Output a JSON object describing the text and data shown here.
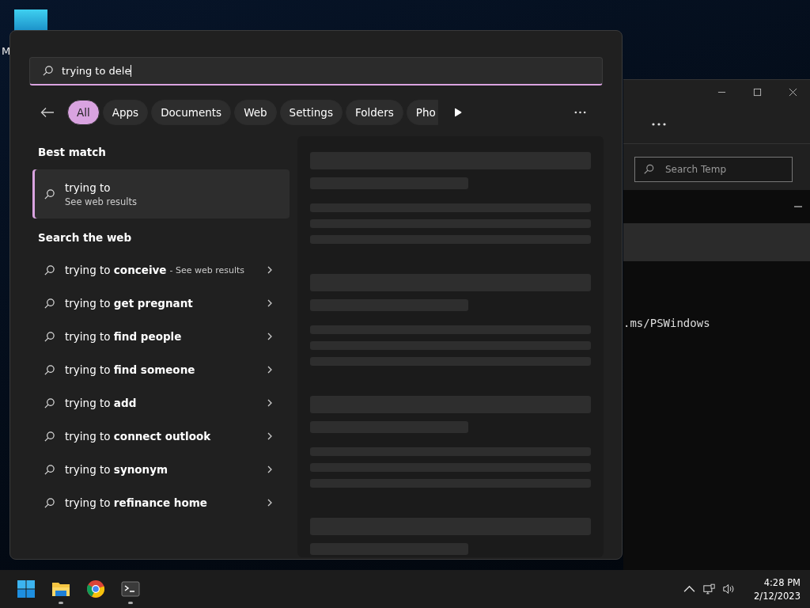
{
  "desktop": {
    "icon_label": "M"
  },
  "explorer_window": {
    "search_placeholder": "Search Temp"
  },
  "terminal_window": {
    "line": ".ms/PSWindows"
  },
  "search": {
    "query": "trying to dele",
    "filters": [
      {
        "label": "All",
        "selected": true
      },
      {
        "label": "Apps",
        "selected": false
      },
      {
        "label": "Documents",
        "selected": false
      },
      {
        "label": "Web",
        "selected": false
      },
      {
        "label": "Settings",
        "selected": false
      },
      {
        "label": "Folders",
        "selected": false
      },
      {
        "label": "Pho",
        "selected": false
      }
    ],
    "best_match": {
      "heading": "Best match",
      "title": "trying to",
      "subtitle": "See web results",
      "selected": true
    },
    "web": {
      "heading": "Search the web",
      "suggestions": [
        {
          "text": "trying to **conceive**",
          "note": "- See web results"
        },
        {
          "text": "trying to **get pregnant**"
        },
        {
          "text": "trying to **find people**"
        },
        {
          "text": "trying to **find someone**"
        },
        {
          "text": "trying to **add**"
        },
        {
          "text": "trying to **connect outlook**"
        },
        {
          "text": "trying to **synonym**"
        },
        {
          "text": "trying to **refinance home**"
        }
      ]
    }
  },
  "taskbar": {
    "apps": [
      {
        "kind": "start",
        "running": false
      },
      {
        "kind": "files",
        "running": true
      },
      {
        "kind": "browser",
        "running": false
      },
      {
        "kind": "terminal",
        "running": true
      }
    ],
    "time": "4:28 PM",
    "date": "2/12/2023"
  }
}
